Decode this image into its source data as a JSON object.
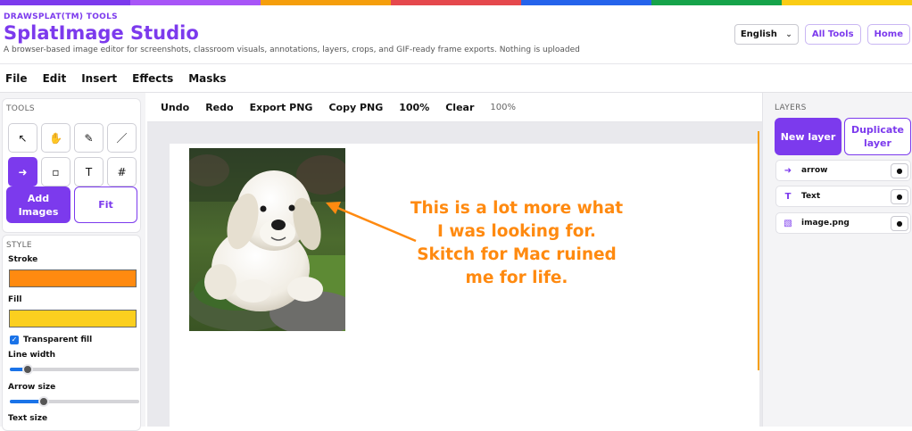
{
  "rainbow_colors": [
    "#7c3aed",
    "#a855f7",
    "#f59e0b",
    "#e5484d",
    "#2563eb",
    "#16a34a",
    "#facc15"
  ],
  "header": {
    "kicker": "DRAWSPLAT(TM) TOOLS",
    "title": "SplatImage Studio",
    "subtitle": "A browser-based image editor for screenshots, classroom visuals, annotations, layers, crops, and GIF-ready frame exports. Nothing is uploaded",
    "language": "English",
    "all_tools": "All Tools",
    "home": "Home"
  },
  "menu": [
    "File",
    "Edit",
    "Insert",
    "Effects",
    "Masks"
  ],
  "tools": {
    "title": "TOOLS",
    "items": [
      {
        "name": "select-tool",
        "icon": "pointer-icon",
        "glyph": "↖",
        "active": false
      },
      {
        "name": "pan-tool",
        "icon": "hand-icon",
        "glyph": "✋",
        "active": false
      },
      {
        "name": "pen-tool",
        "icon": "pen-icon",
        "glyph": "✎",
        "active": false
      },
      {
        "name": "line-tool",
        "icon": "line-icon",
        "glyph": "／",
        "active": false
      },
      {
        "name": "arrow-tool",
        "icon": "arrow-icon",
        "glyph": "➜",
        "active": true
      },
      {
        "name": "rectangle-tool",
        "icon": "rectangle-icon",
        "glyph": "▫",
        "active": false
      },
      {
        "name": "text-tool",
        "icon": "text-icon",
        "glyph": "T",
        "active": false
      },
      {
        "name": "grid-tool",
        "icon": "hash-icon",
        "glyph": "#",
        "active": false
      }
    ],
    "add_images": "Add Images",
    "fit": "Fit"
  },
  "style": {
    "title": "STYLE",
    "stroke_label": "Stroke",
    "stroke_color": "#ff8a10",
    "fill_label": "Fill",
    "fill_color": "#fbcf1f",
    "transparent_fill_label": "Transparent fill",
    "transparent_fill_checked": true,
    "line_width_label": "Line width",
    "line_width_level": 0.14,
    "arrow_size_label": "Arrow size",
    "arrow_size_level": 0.26,
    "text_size_label": "Text size"
  },
  "toolbar": {
    "undo": "Undo",
    "redo": "Redo",
    "export_png": "Export PNG",
    "copy_png": "Copy PNG",
    "zoom_button": "100%",
    "clear": "Clear",
    "zoom_readout": "100%"
  },
  "canvas": {
    "annotation_text": "This is a lot more what I was looking for. Skitch for Mac ruined me for life.",
    "annotation_color": "#ff8a10"
  },
  "layers": {
    "title": "LAYERS",
    "new_layer": "New layer",
    "duplicate_layer": "Duplicate layer",
    "items": [
      {
        "name": "arrow",
        "icon": "arrow-icon",
        "glyph": "➜"
      },
      {
        "name": "Text",
        "icon": "text-icon",
        "glyph": "T"
      },
      {
        "name": "image.png",
        "icon": "image-icon",
        "glyph": "▧"
      }
    ],
    "visibility_glyph": "●"
  }
}
